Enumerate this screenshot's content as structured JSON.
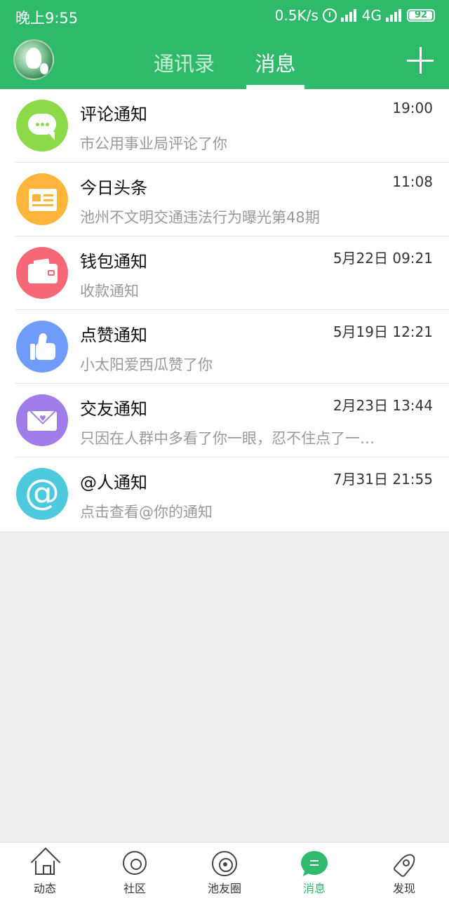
{
  "status_bar": {
    "time": "晚上9:55",
    "speed": "0.5K/s",
    "network": "4G",
    "battery": "92",
    "icons": [
      "alarm-icon",
      "hd-signal-icon",
      "signal-icon",
      "battery-icon"
    ]
  },
  "header": {
    "avatar_icon": "avatar",
    "tabs": [
      {
        "label": "通讯录",
        "active": false
      },
      {
        "label": "消息",
        "active": true
      }
    ],
    "add_icon": "plus-icon",
    "bg_color": "#2fba6b"
  },
  "messages": [
    {
      "title": "评论通知",
      "time": "19:00",
      "preview": "市公用事业局评论了你",
      "icon": "comment-bubble-icon",
      "color": "#8cd94a"
    },
    {
      "title": "今日头条",
      "time": "11:08",
      "preview": "池州不文明交通违法行为曝光第48期",
      "icon": "newspaper-icon",
      "color": "#ffb53b"
    },
    {
      "title": "钱包通知",
      "time": "5月22日 09:21",
      "preview": "收款通知",
      "icon": "wallet-icon",
      "color": "#f76877"
    },
    {
      "title": "点赞通知",
      "time": "5月19日 12:21",
      "preview": "小太阳爱西瓜赞了你",
      "icon": "thumbs-up-icon",
      "color": "#6f9bfb"
    },
    {
      "title": "交友通知",
      "time": "2月23日 13:44",
      "preview": "只因在人群中多看了你一眼，忍不住点了一…",
      "icon": "envelope-heart-icon",
      "color": "#a07de8"
    },
    {
      "title": "@人通知",
      "time": "7月31日 21:55",
      "preview": "点击查看@你的通知",
      "icon": "at-sign-icon",
      "color": "#4dc9de",
      "glyph": "@"
    }
  ],
  "bottom_nav": [
    {
      "label": "动态",
      "icon": "home-icon",
      "active": false
    },
    {
      "label": "社区",
      "icon": "community-icon",
      "active": false
    },
    {
      "label": "池友圈",
      "icon": "moments-circle-icon",
      "active": false
    },
    {
      "label": "消息",
      "icon": "message-icon",
      "active": true
    },
    {
      "label": "发现",
      "icon": "rocket-icon",
      "active": false
    }
  ]
}
